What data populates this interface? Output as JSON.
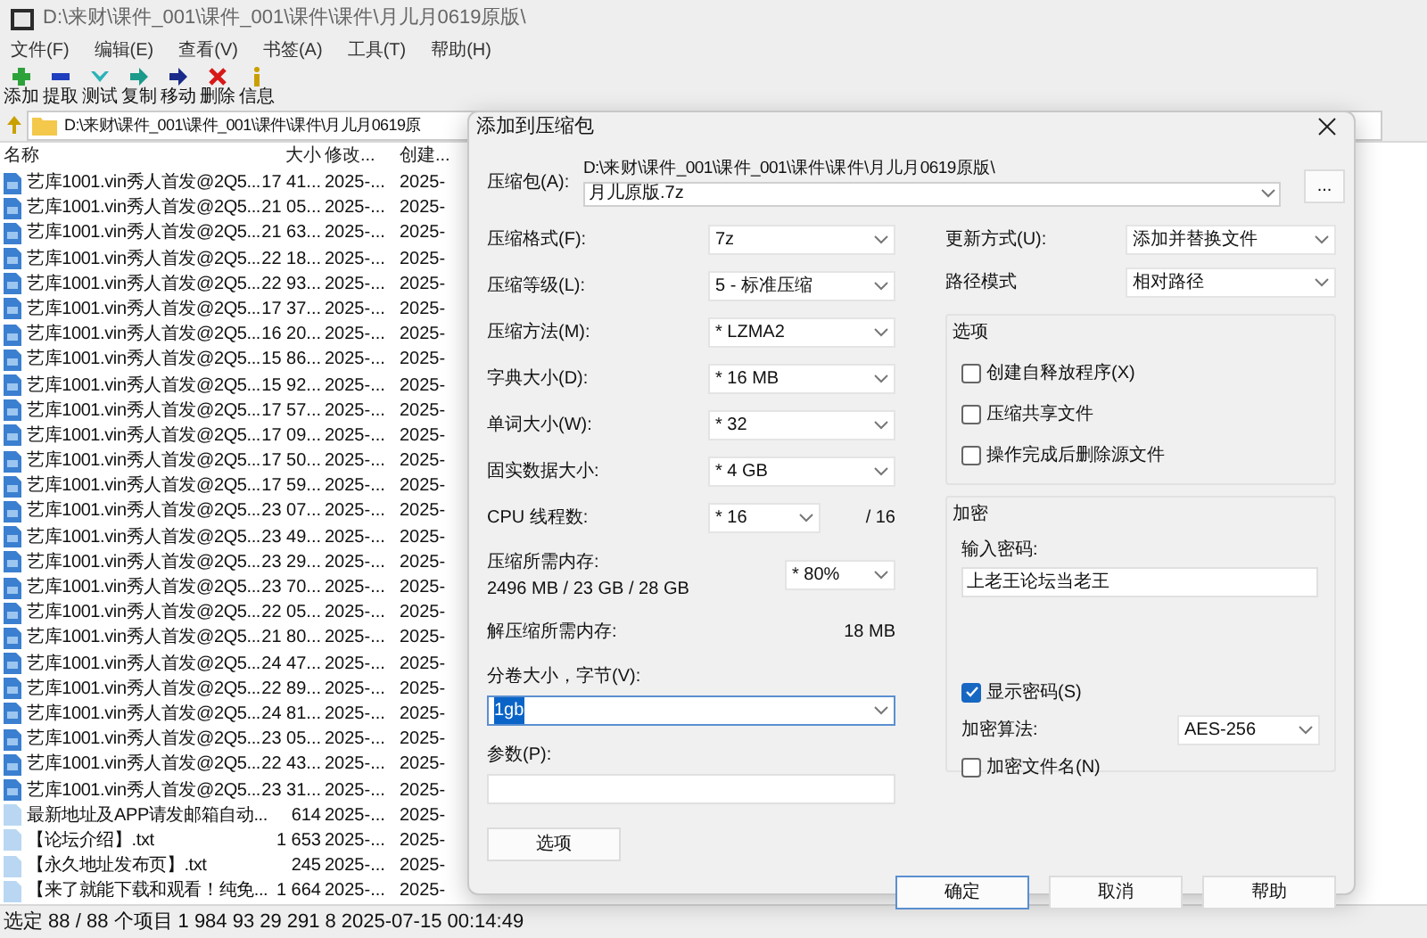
{
  "window": {
    "title": "D:\\来财\\课件_001\\课件_001\\课件\\课件\\月儿月0619原版\\"
  },
  "menu": [
    "文件(F)",
    "编辑(E)",
    "查看(V)",
    "书签(A)",
    "工具(T)",
    "帮助(H)"
  ],
  "toolbar": [
    {
      "kind": "add",
      "label": "添加"
    },
    {
      "kind": "extract",
      "label": "提取"
    },
    {
      "kind": "test",
      "label": "测试"
    },
    {
      "kind": "copy",
      "label": "复制"
    },
    {
      "kind": "move",
      "label": "移动"
    },
    {
      "kind": "delete",
      "label": "删除"
    },
    {
      "kind": "info",
      "label": "信息"
    }
  ],
  "address": "D:\\来财\\课件_001\\课件_001\\课件\\课件\\月儿月0619原",
  "columns": [
    "名称",
    "大小",
    "修改...",
    "创建..."
  ],
  "files": [
    {
      "kind": "archive",
      "name": "艺库1001.vin秀人首发@2Q5...",
      "size": "17 41...",
      "modified": "2025-...",
      "created": "2025-"
    },
    {
      "kind": "archive",
      "name": "艺库1001.vin秀人首发@2Q5...",
      "size": "21 05...",
      "modified": "2025-...",
      "created": "2025-"
    },
    {
      "kind": "archive",
      "name": "艺库1001.vin秀人首发@2Q5...",
      "size": "21 63...",
      "modified": "2025-...",
      "created": "2025-"
    },
    {
      "kind": "archive",
      "name": "艺库1001.vin秀人首发@2Q5...",
      "size": "22 18...",
      "modified": "2025-...",
      "created": "2025-"
    },
    {
      "kind": "archive",
      "name": "艺库1001.vin秀人首发@2Q5...",
      "size": "22 93...",
      "modified": "2025-...",
      "created": "2025-"
    },
    {
      "kind": "archive",
      "name": "艺库1001.vin秀人首发@2Q5...",
      "size": "17 37...",
      "modified": "2025-...",
      "created": "2025-"
    },
    {
      "kind": "archive",
      "name": "艺库1001.vin秀人首发@2Q5...",
      "size": "16 20...",
      "modified": "2025-...",
      "created": "2025-"
    },
    {
      "kind": "archive",
      "name": "艺库1001.vin秀人首发@2Q5...",
      "size": "15 86...",
      "modified": "2025-...",
      "created": "2025-"
    },
    {
      "kind": "archive",
      "name": "艺库1001.vin秀人首发@2Q5...",
      "size": "15 92...",
      "modified": "2025-...",
      "created": "2025-"
    },
    {
      "kind": "archive",
      "name": "艺库1001.vin秀人首发@2Q5...",
      "size": "17 57...",
      "modified": "2025-...",
      "created": "2025-"
    },
    {
      "kind": "archive",
      "name": "艺库1001.vin秀人首发@2Q5...",
      "size": "17 09...",
      "modified": "2025-...",
      "created": "2025-"
    },
    {
      "kind": "archive",
      "name": "艺库1001.vin秀人首发@2Q5...",
      "size": "17 50...",
      "modified": "2025-...",
      "created": "2025-"
    },
    {
      "kind": "archive",
      "name": "艺库1001.vin秀人首发@2Q5...",
      "size": "17 59...",
      "modified": "2025-...",
      "created": "2025-"
    },
    {
      "kind": "archive",
      "name": "艺库1001.vin秀人首发@2Q5...",
      "size": "23 07...",
      "modified": "2025-...",
      "created": "2025-"
    },
    {
      "kind": "archive",
      "name": "艺库1001.vin秀人首发@2Q5...",
      "size": "23 49...",
      "modified": "2025-...",
      "created": "2025-"
    },
    {
      "kind": "archive",
      "name": "艺库1001.vin秀人首发@2Q5...",
      "size": "23 29...",
      "modified": "2025-...",
      "created": "2025-"
    },
    {
      "kind": "archive",
      "name": "艺库1001.vin秀人首发@2Q5...",
      "size": "23 70...",
      "modified": "2025-...",
      "created": "2025-"
    },
    {
      "kind": "archive",
      "name": "艺库1001.vin秀人首发@2Q5...",
      "size": "22 05...",
      "modified": "2025-...",
      "created": "2025-"
    },
    {
      "kind": "archive",
      "name": "艺库1001.vin秀人首发@2Q5...",
      "size": "21 80...",
      "modified": "2025-...",
      "created": "2025-"
    },
    {
      "kind": "archive",
      "name": "艺库1001.vin秀人首发@2Q5...",
      "size": "24 47...",
      "modified": "2025-...",
      "created": "2025-"
    },
    {
      "kind": "archive",
      "name": "艺库1001.vin秀人首发@2Q5...",
      "size": "22 89...",
      "modified": "2025-...",
      "created": "2025-"
    },
    {
      "kind": "archive",
      "name": "艺库1001.vin秀人首发@2Q5...",
      "size": "24 81...",
      "modified": "2025-...",
      "created": "2025-"
    },
    {
      "kind": "archive",
      "name": "艺库1001.vin秀人首发@2Q5...",
      "size": "23 05...",
      "modified": "2025-...",
      "created": "2025-"
    },
    {
      "kind": "archive",
      "name": "艺库1001.vin秀人首发@2Q5...",
      "size": "22 43...",
      "modified": "2025-...",
      "created": "2025-"
    },
    {
      "kind": "archive",
      "name": "艺库1001.vin秀人首发@2Q5...",
      "size": "23 31...",
      "modified": "2025-...",
      "created": "2025-"
    },
    {
      "kind": "text",
      "name": "最新地址及APP请发邮箱自动...",
      "size": "614",
      "modified": "2025-...",
      "created": "2025-"
    },
    {
      "kind": "text",
      "name": "【论坛介绍】.txt",
      "size": "1 653",
      "modified": "2025-...",
      "created": "2025-"
    },
    {
      "kind": "text",
      "name": "【永久地址发布页】.txt",
      "size": "245",
      "modified": "2025-...",
      "created": "2025-"
    },
    {
      "kind": "text",
      "name": "【来了就能下载和观看！纯免...",
      "size": "1 664",
      "modified": "2025-...",
      "created": "2025-"
    }
  ],
  "status_bar": [
    "选定 88 / 88 个项目",
    "1 984 93",
    "29 291 8",
    "2025-07-15 00:14:49"
  ],
  "dialog": {
    "title": "添加到压缩包",
    "archive": {
      "label": "压缩包(A):",
      "folder": "D:\\来财\\课件_001\\课件_001\\课件\\课件\\月儿月0619原版\\",
      "name": "月儿原版.7z",
      "browse": "..."
    },
    "settings": [
      {
        "kind": "combo",
        "label": "压缩格式(F):",
        "value": "7z"
      },
      {
        "kind": "combo",
        "label": "压缩等级(L):",
        "value": "5 - 标准压缩"
      },
      {
        "kind": "combo",
        "label": "压缩方法(M):",
        "value": "* LZMA2"
      },
      {
        "kind": "combo",
        "label": "字典大小(D):",
        "value": "* 16 MB"
      },
      {
        "kind": "combo",
        "label": "单词大小(W):",
        "value": "* 32"
      },
      {
        "kind": "combo",
        "label": "固实数据大小:",
        "value": "* 4 GB"
      },
      {
        "kind": "threads",
        "label": "CPU 线程数:",
        "value": "* 16",
        "total": "/ 16"
      },
      {
        "kind": "memory",
        "label": "压缩所需内存:",
        "detail": "2496 MB / 23 GB / 28 GB",
        "value": "* 80%"
      },
      {
        "kind": "reading",
        "label": "解压缩所需内存:",
        "value": "18 MB"
      }
    ],
    "volume": {
      "label": "分卷大小，字节(V):",
      "value": "1gb",
      "selected": true
    },
    "parameters": {
      "label": "参数(P):"
    },
    "options_button": "选项",
    "update_mode": {
      "label": "更新方式(U):",
      "value": "添加并替换文件"
    },
    "path_mode": {
      "label": "路径模式",
      "value": "相对路径"
    },
    "options": {
      "title": "选项",
      "items": [
        {
          "label": "创建自释放程序(X)",
          "checked": false
        },
        {
          "label": "压缩共享文件",
          "checked": false
        },
        {
          "label": "操作完成后删除源文件",
          "checked": false
        }
      ]
    },
    "encryption": {
      "title": "加密",
      "password_label": "输入密码:",
      "password": "上老王论坛当老王",
      "show_password": {
        "label": "显示密码(S)",
        "checked": true
      },
      "method_label": "加密算法:",
      "method": "AES-256",
      "encrypt_names": {
        "label": "加密文件名(N)",
        "checked": false
      }
    },
    "buttons": [
      {
        "label": "确定",
        "default": true
      },
      {
        "label": "取消",
        "default": false
      },
      {
        "label": "帮助",
        "default": false
      }
    ]
  }
}
